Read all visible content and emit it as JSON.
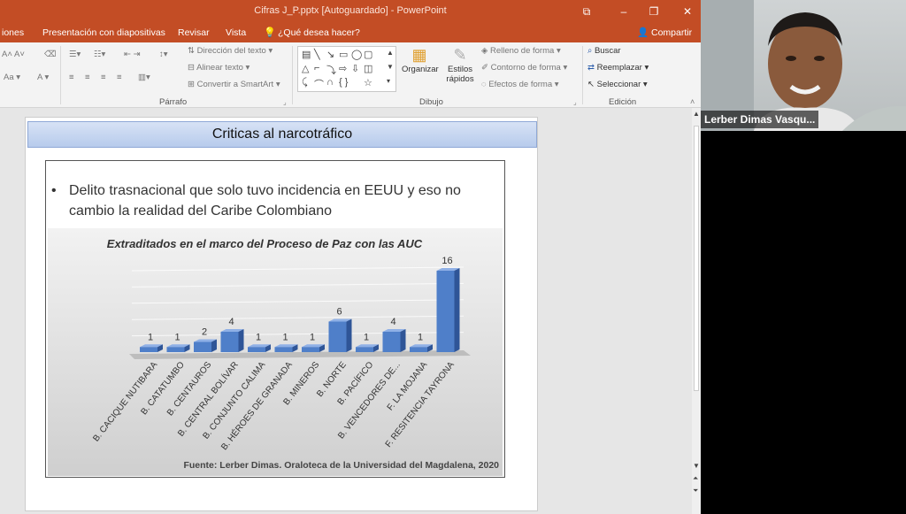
{
  "window": {
    "title": "Cifras J_P.pptx [Autoguardado] - PowerPoint",
    "controls": {
      "restore": "⧉",
      "minimize": "–",
      "maximize": "❐",
      "close": "✕"
    }
  },
  "tabs": {
    "items": [
      "iones",
      "Presentación con diapositivas",
      "Revisar",
      "Vista"
    ],
    "tell_me": "¿Qué desea hacer?",
    "share": "Compartir"
  },
  "ribbon": {
    "parrafo": {
      "label": "Párrafo",
      "text_direction": "Dirección del texto",
      "align_text": "Alinear texto",
      "smartart": "Convertir a SmartArt"
    },
    "dibujo": {
      "label": "Dibujo",
      "arrange": "Organizar",
      "quick_styles_1": "Estilos",
      "quick_styles_2": "rápidos",
      "shape_fill": "Relleno de forma",
      "shape_outline": "Contorno de forma",
      "shape_effects": "Efectos de forma"
    },
    "edicion": {
      "label": "Edición",
      "find": "Buscar",
      "replace": "Reemplazar",
      "select": "Seleccionar"
    }
  },
  "slide": {
    "title": "Criticas al narcotráfico",
    "bullet_marker": "•",
    "bullet": "Delito trasnacional que solo tuvo incidencia en EEUU y eso no cambio la realidad del Caribe Colombiano",
    "source": "Fuente: Lerber Dimas. Oraloteca de la Universidad del Magdalena, 2020"
  },
  "chart_data": {
    "type": "bar",
    "title": "Extraditados en el marco del Proceso de Paz con las AUC",
    "categories": [
      "B. CACIQUE NUTIBARA",
      "B. CATATUMBO",
      "B. CENTAUROS",
      "B. CENTRAL BOLÍVAR",
      "B. CONJUNTO CALIMA",
      "B. HÉROES DE GRANADA",
      "B. MINEROS",
      "B. NORTE",
      "B. PACÍFICO",
      "B. VENCEDORES DE...",
      "F. LA MOJANA",
      "F. RESITENCIA TAYRONA"
    ],
    "values": [
      1,
      1,
      2,
      4,
      1,
      1,
      1,
      6,
      1,
      4,
      1,
      16
    ],
    "xlabel": "",
    "ylabel": "",
    "grid": true,
    "bar_color": "#4f7fc9"
  },
  "video": {
    "participant_name": "Lerber Dimas Vasqu..."
  }
}
